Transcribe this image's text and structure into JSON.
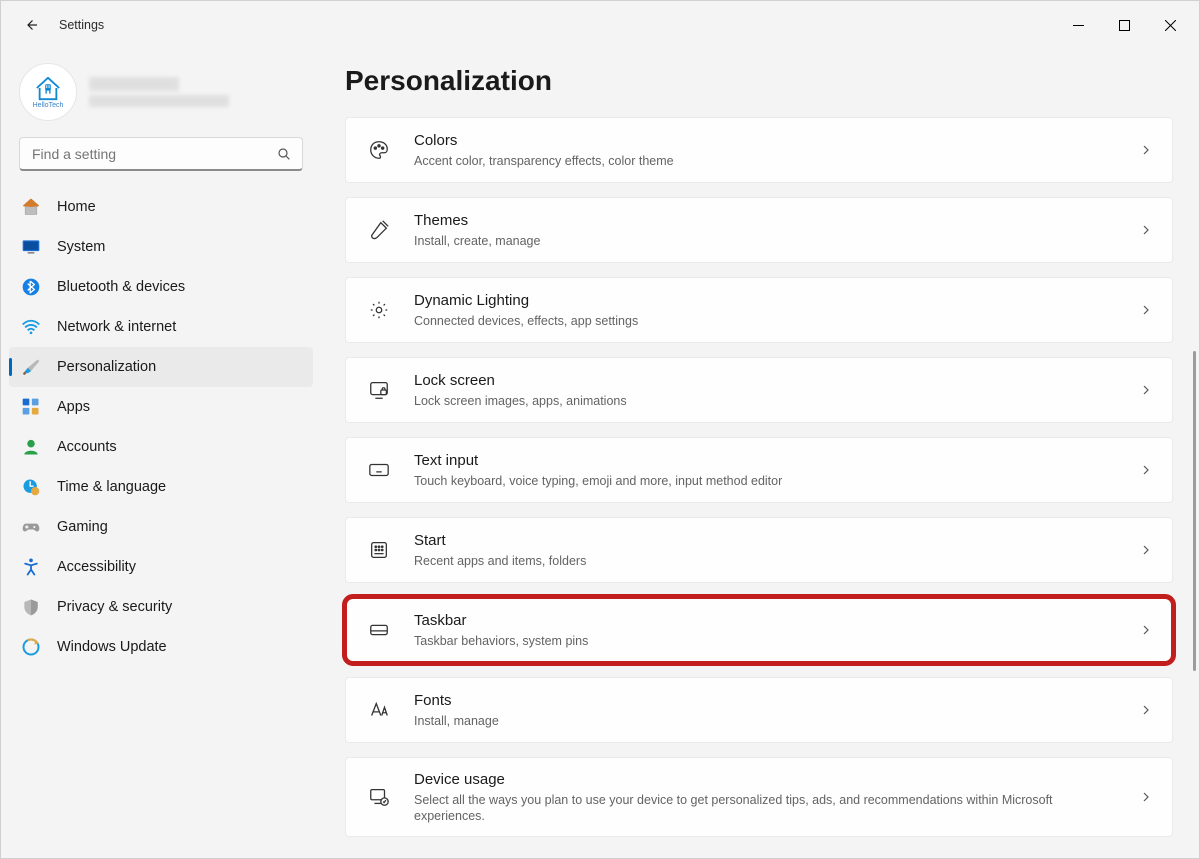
{
  "app": {
    "title": "Settings"
  },
  "account": {
    "avatar_label": "HelloTech"
  },
  "search": {
    "placeholder": "Find a setting"
  },
  "sidebar": [
    {
      "key": "home",
      "label": "Home",
      "selected": false
    },
    {
      "key": "system",
      "label": "System",
      "selected": false
    },
    {
      "key": "bluetooth",
      "label": "Bluetooth & devices",
      "selected": false
    },
    {
      "key": "network",
      "label": "Network & internet",
      "selected": false
    },
    {
      "key": "personalization",
      "label": "Personalization",
      "selected": true
    },
    {
      "key": "apps",
      "label": "Apps",
      "selected": false
    },
    {
      "key": "accounts",
      "label": "Accounts",
      "selected": false
    },
    {
      "key": "time",
      "label": "Time & language",
      "selected": false
    },
    {
      "key": "gaming",
      "label": "Gaming",
      "selected": false
    },
    {
      "key": "accessibility",
      "label": "Accessibility",
      "selected": false
    },
    {
      "key": "privacy",
      "label": "Privacy & security",
      "selected": false
    },
    {
      "key": "update",
      "label": "Windows Update",
      "selected": false
    }
  ],
  "page": {
    "title": "Personalization"
  },
  "cards": [
    {
      "key": "colors",
      "title": "Colors",
      "desc": "Accent color, transparency effects, color theme",
      "highlight": false
    },
    {
      "key": "themes",
      "title": "Themes",
      "desc": "Install, create, manage",
      "highlight": false
    },
    {
      "key": "dynamic-lighting",
      "title": "Dynamic Lighting",
      "desc": "Connected devices, effects, app settings",
      "highlight": false
    },
    {
      "key": "lock-screen",
      "title": "Lock screen",
      "desc": "Lock screen images, apps, animations",
      "highlight": false
    },
    {
      "key": "text-input",
      "title": "Text input",
      "desc": "Touch keyboard, voice typing, emoji and more, input method editor",
      "highlight": false
    },
    {
      "key": "start",
      "title": "Start",
      "desc": "Recent apps and items, folders",
      "highlight": false
    },
    {
      "key": "taskbar",
      "title": "Taskbar",
      "desc": "Taskbar behaviors, system pins",
      "highlight": true
    },
    {
      "key": "fonts",
      "title": "Fonts",
      "desc": "Install, manage",
      "highlight": false
    },
    {
      "key": "device-usage",
      "title": "Device usage",
      "desc": "Select all the ways you plan to use your device to get personalized tips, ads, and recommendations within Microsoft experiences.",
      "highlight": false
    }
  ]
}
